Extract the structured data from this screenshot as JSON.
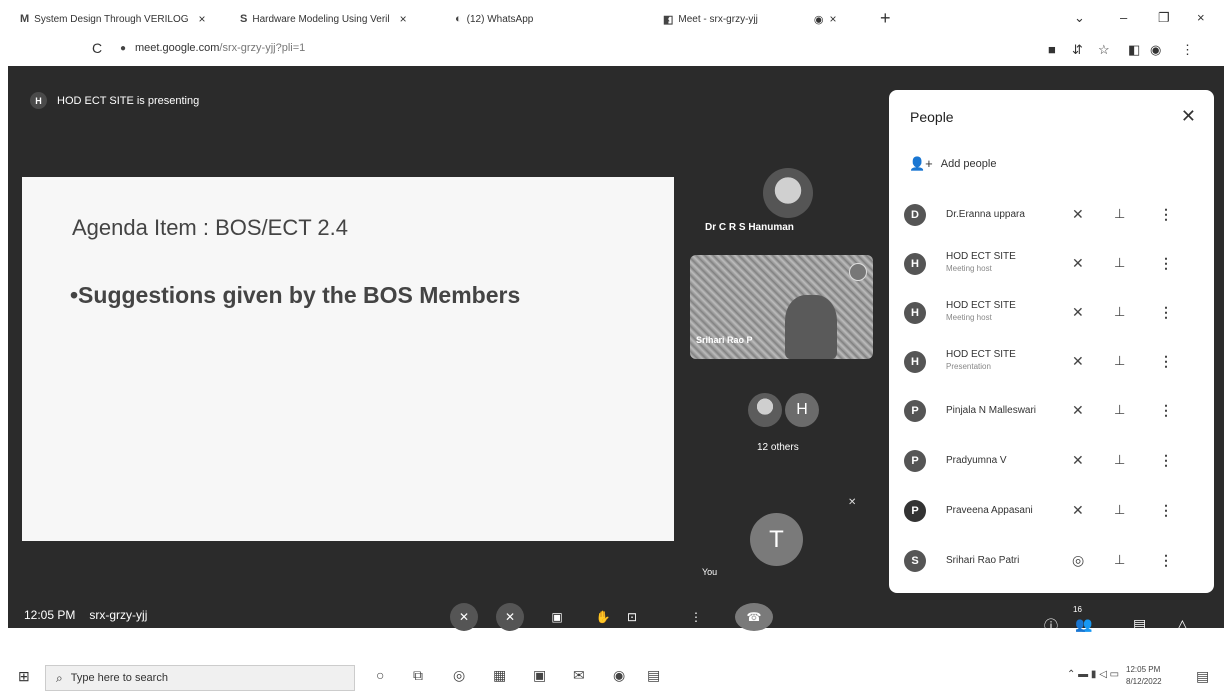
{
  "browser": {
    "tabs": [
      {
        "icon": "M",
        "title": "System Design Through VERILOG"
      },
      {
        "icon": "S",
        "title": "Hardware Modeling Using Veril"
      },
      {
        "icon": "◐",
        "title": "(12) WhatsApp"
      },
      {
        "icon": "◧",
        "title": "Meet - srx-grzy-yjj"
      }
    ],
    "tab_close": "×",
    "new_tab": "+",
    "window": {
      "dropdown": "⌄",
      "minimize": "–",
      "restore": "❐",
      "close": "×"
    },
    "reload": "C",
    "lock": "🔒",
    "url_host": "meet.google.com",
    "url_path": "/srx-grzy-yjj?pli=1"
  },
  "meet": {
    "presenter_initial": "H",
    "presenting_text": "HOD ECT SITE is presenting",
    "slide": {
      "title": "Agenda Item : BOS/ECT 2.4",
      "bullet": "•Suggestions given by the BOS Members"
    },
    "tile1_name": "Dr C R S Hanuman",
    "tile2_name": "Srihari Rao P",
    "others_initial": "H",
    "others_label": "12 others",
    "you_initial": "T",
    "you_label": "You",
    "time": "12:05 PM",
    "meeting_code": "srx-grzy-yjj",
    "people_count_badge": "16"
  },
  "people_panel": {
    "title": "People",
    "add_people": "Add people",
    "participants": [
      {
        "initial": "D",
        "name": "Dr.Eranna uppara",
        "role": ""
      },
      {
        "initial": "H",
        "name": "HOD ECT SITE",
        "role": "Meeting host"
      },
      {
        "initial": "H",
        "name": "HOD ECT SITE",
        "role": "Meeting host"
      },
      {
        "initial": "H",
        "name": "HOD ECT SITE",
        "role": "Presentation"
      },
      {
        "initial": "P",
        "name": "Pinjala N Malleswari",
        "role": ""
      },
      {
        "initial": "P",
        "name": "Pradyumna V",
        "role": ""
      },
      {
        "initial": "P",
        "name": "Praveena Appasani",
        "role": ""
      },
      {
        "initial": "S",
        "name": "Srihari Rao Patri",
        "role": ""
      }
    ]
  },
  "taskbar": {
    "search_placeholder": "Type here to search",
    "clock_time": "12:05 PM",
    "clock_date": "8/12/2022"
  }
}
